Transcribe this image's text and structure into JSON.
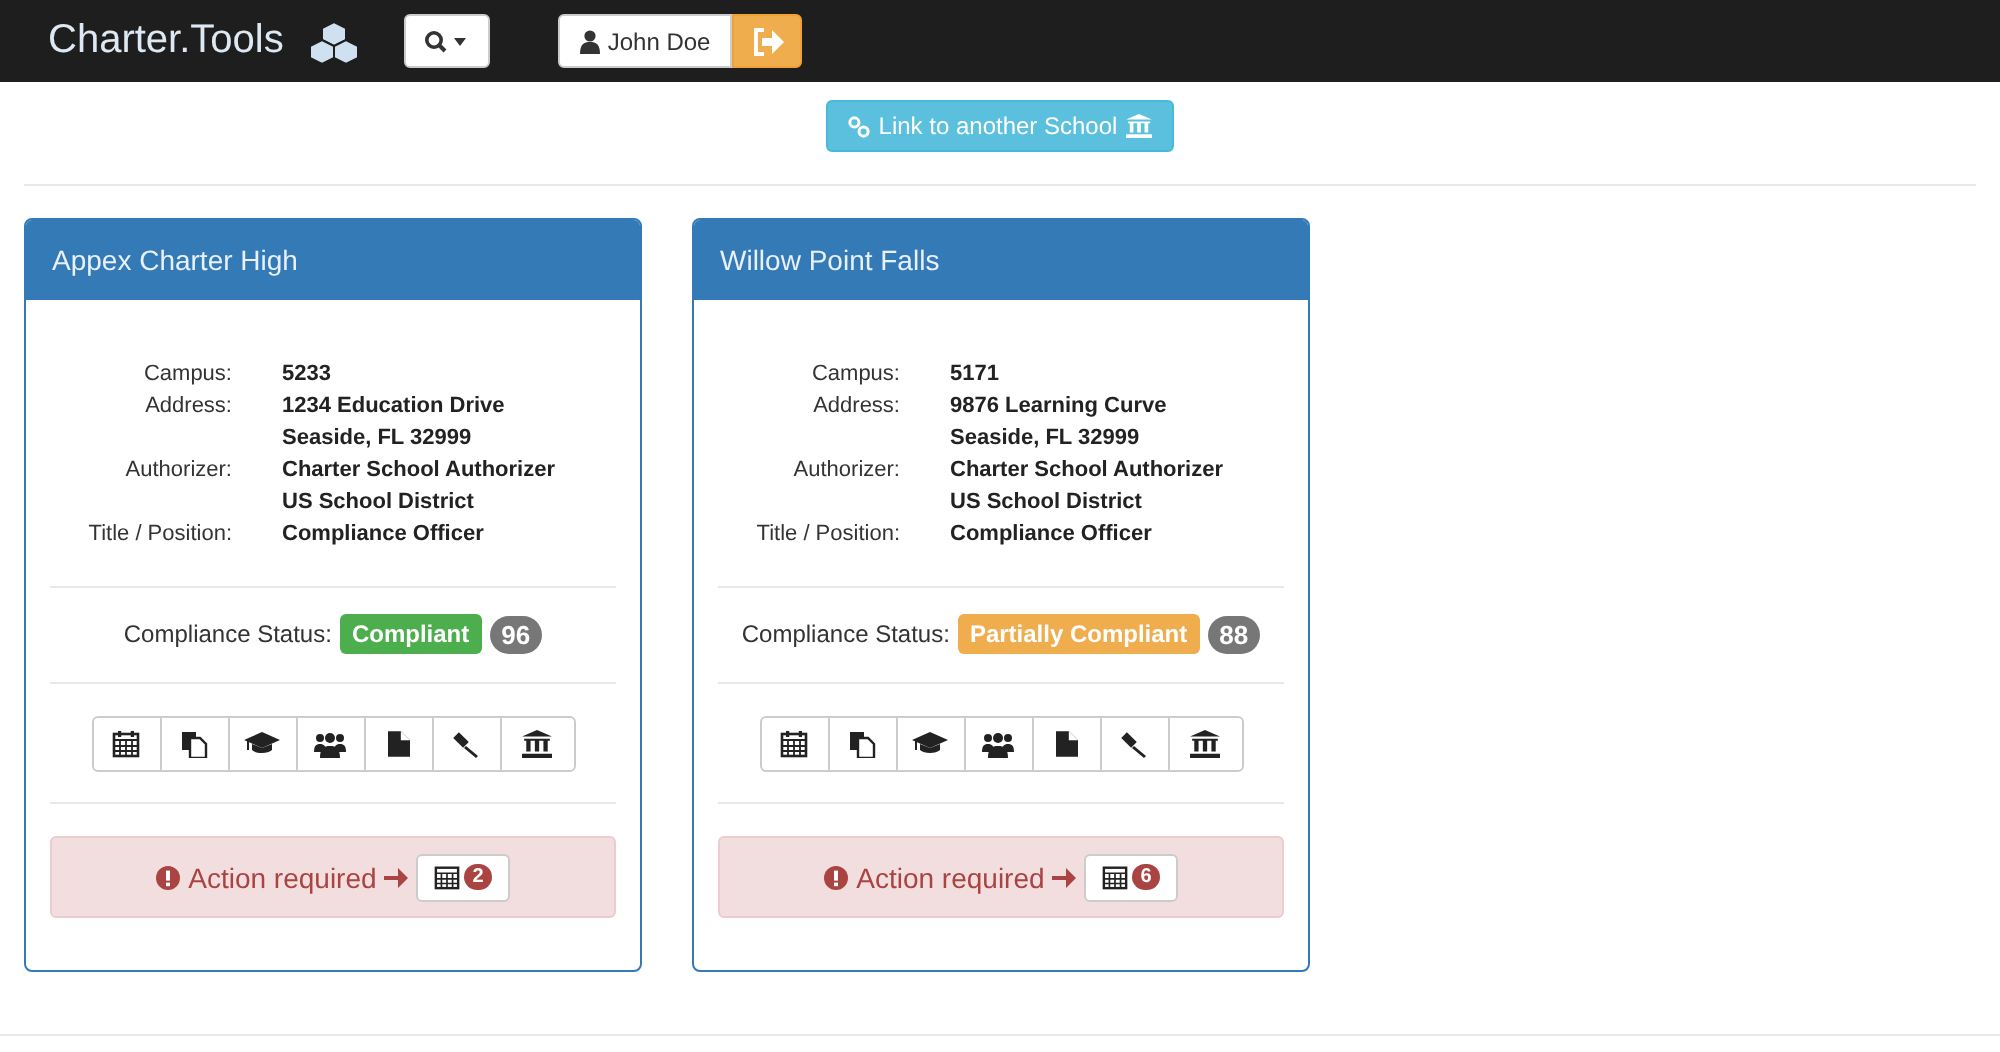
{
  "navbar": {
    "brand": "Charter.Tools",
    "user": "John Doe"
  },
  "link_button": {
    "label": "Link to another School"
  },
  "schools": [
    {
      "name": "Appex Charter High",
      "details": [
        {
          "label": "Campus:",
          "lines": [
            "5233"
          ]
        },
        {
          "label": "Address:",
          "lines": [
            "1234 Education Drive",
            "Seaside, FL 32999"
          ]
        },
        {
          "label": "Authorizer:",
          "lines": [
            "Charter School Authorizer",
            "US School District"
          ]
        },
        {
          "label": "Title / Position:",
          "lines": [
            "Compliance Officer"
          ]
        }
      ],
      "status_label": "Compliance Status:",
      "status": {
        "kind": "compliant",
        "text": "Compliant"
      },
      "score": "96",
      "alert": {
        "text": "Action required",
        "count": "2"
      }
    },
    {
      "name": "Willow Point Falls",
      "details": [
        {
          "label": "Campus:",
          "lines": [
            "5171"
          ]
        },
        {
          "label": "Address:",
          "lines": [
            "9876 Learning Curve",
            "Seaside, FL 32999"
          ]
        },
        {
          "label": "Authorizer:",
          "lines": [
            "Charter School Authorizer",
            "US School District"
          ]
        },
        {
          "label": "Title / Position:",
          "lines": [
            "Compliance Officer"
          ]
        }
      ],
      "status_label": "Compliance Status:",
      "status": {
        "kind": "partial",
        "text": "Partially Compliant"
      },
      "score": "88",
      "alert": {
        "text": "Action required",
        "count": "6"
      }
    }
  ]
}
